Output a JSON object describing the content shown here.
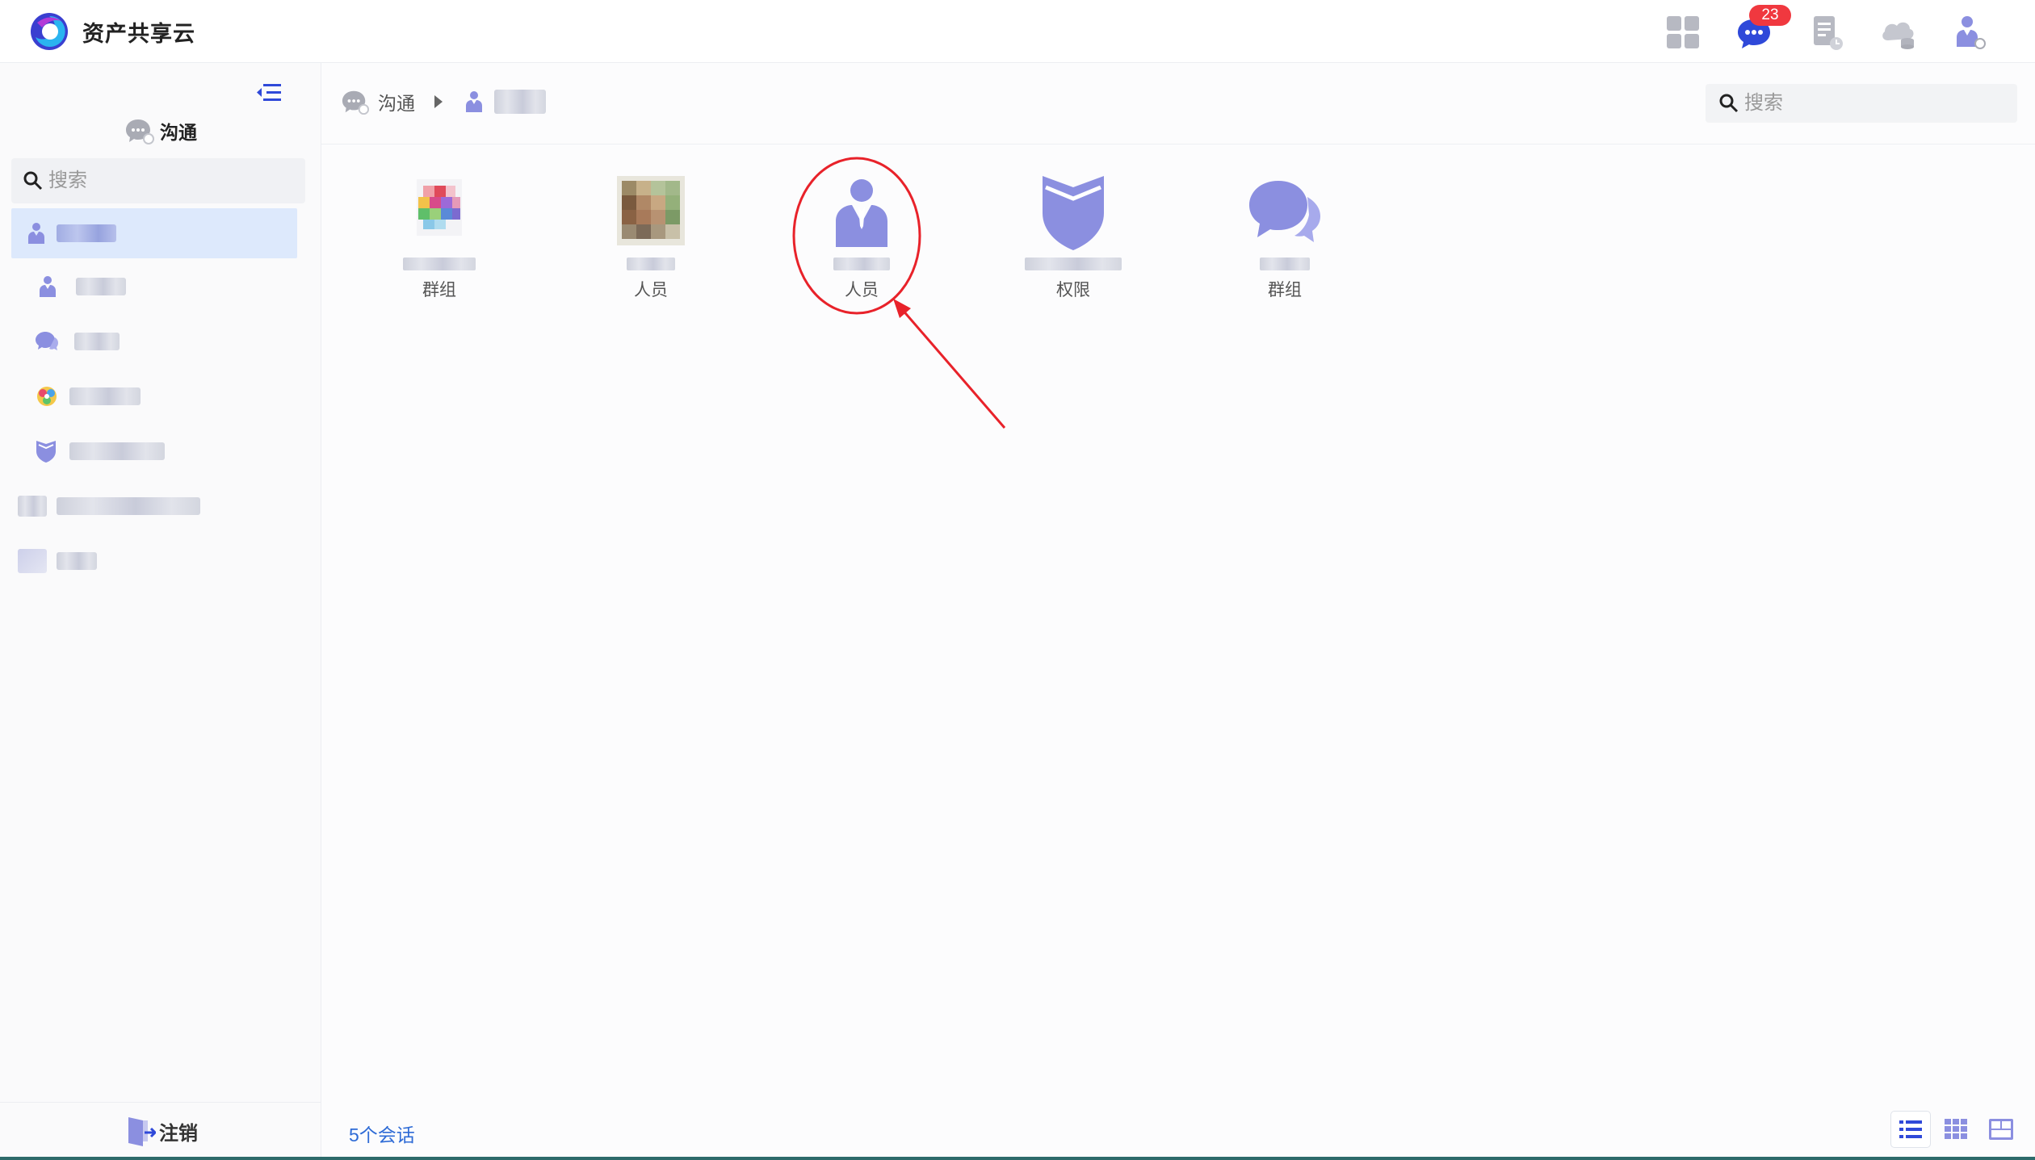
{
  "app": {
    "title": "资产共享云"
  },
  "topbar": {
    "icons": [
      "apps-grid-icon",
      "chat-icon",
      "document-icon",
      "cloud-storage-icon",
      "user-profile-icon"
    ],
    "chat_badge": "23"
  },
  "sidebar": {
    "title": "沟通",
    "search_placeholder": "搜索",
    "items": [
      {
        "icon": "person-icon",
        "active": true
      },
      {
        "icon": "person-icon"
      },
      {
        "icon": "chat-bubble-icon"
      },
      {
        "icon": "group-avatar-icon"
      },
      {
        "icon": "shield-icon"
      },
      {
        "icon": "folder-icon"
      },
      {
        "icon": "folder-icon"
      }
    ],
    "logout_label": "注销"
  },
  "breadcrumb": {
    "root": "沟通"
  },
  "main": {
    "search_placeholder": "搜索",
    "tiles": [
      {
        "label": "群组",
        "icon": "group-avatar-icon"
      },
      {
        "label": "人员",
        "icon": "photo-avatar-icon"
      },
      {
        "label": "人员",
        "icon": "person-icon",
        "highlighted": true
      },
      {
        "label": "权限",
        "icon": "shield-icon"
      },
      {
        "label": "群组",
        "icon": "chat-bubble-icon"
      }
    ],
    "conversation_count": "5个会话"
  },
  "colors": {
    "accent": "#2e6bd6",
    "icon_purple": "#8b8fe0",
    "badge_red": "#f0383f",
    "annotation_red": "#e8222a"
  }
}
